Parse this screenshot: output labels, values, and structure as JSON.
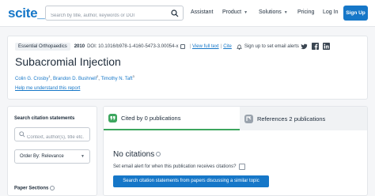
{
  "header": {
    "logo": "scite_",
    "search_placeholder": "Search by title, author, keywords or DOI",
    "nav": [
      {
        "label": "Assistant",
        "has_caret": false
      },
      {
        "label": "Product",
        "has_caret": true
      },
      {
        "label": "Solutions",
        "has_caret": true
      },
      {
        "label": "Pricing",
        "has_caret": false
      }
    ],
    "login": "Log In",
    "signup": "Sign Up"
  },
  "publication": {
    "journal": "Essential Orthopaedics",
    "year": "2010",
    "doi": "DOI: 10.1016/b978-1-4160-5473-3.00054-x",
    "view_full_text": "View full text",
    "cite": "Cite",
    "alert": "Sign up to set email alerts",
    "title": "Subacromial Injection",
    "authors": [
      {
        "name": "Colin G. Crosby",
        "sup": "1"
      },
      {
        "name": "Brandon D. Bushnell",
        "sup": "2"
      },
      {
        "name": "Timothy N. Taft",
        "sup": "3"
      }
    ],
    "help": "Help me understand this report"
  },
  "sidebar": {
    "search_title": "Search citation statements",
    "search_placeholder": "Context, author(s), title etc.",
    "order_by": "Order By: Relevance",
    "paper_sections": "Paper Sections"
  },
  "main": {
    "tab_cited": "Cited by 0 publications",
    "tab_refs": "References 2 publications",
    "no_citations": "No citations",
    "set_alert": "Set email alert for when this publication receives citations?",
    "cta": "Search citation statements from papers discussing a similar topic"
  },
  "colors": {
    "brand": "#1677c8",
    "active_tab": "#3da65e"
  }
}
